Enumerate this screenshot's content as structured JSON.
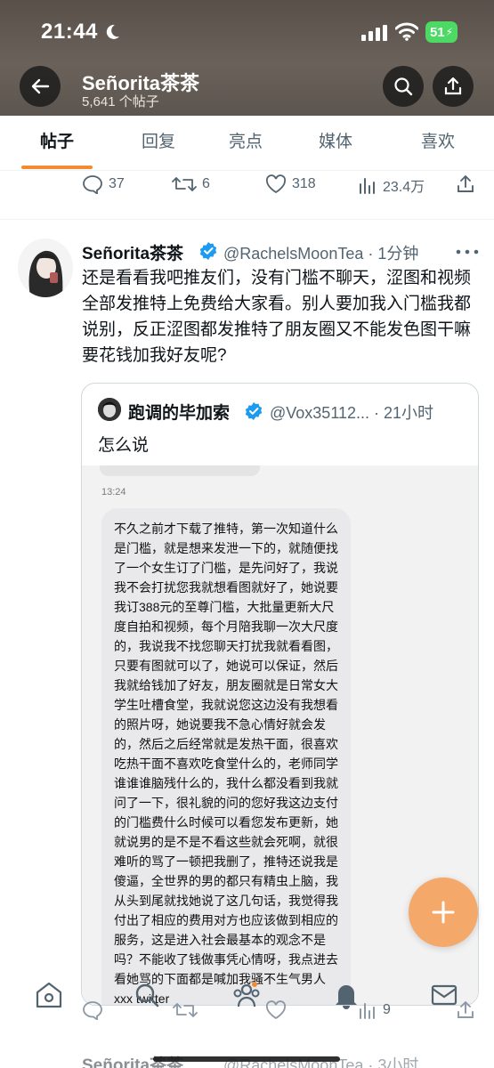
{
  "status_bar": {
    "time": "21:44",
    "battery": "51"
  },
  "profile": {
    "name": "Señorita茶茶",
    "post_count": "5,641 个帖子"
  },
  "tabs": [
    {
      "label": "帖子"
    },
    {
      "label": "回复"
    },
    {
      "label": "亮点"
    },
    {
      "label": "媒体"
    },
    {
      "label": "喜欢"
    }
  ],
  "prev_tweet_actions": {
    "replies": "37",
    "reposts": "6",
    "likes": "318",
    "views": "23.4万"
  },
  "tweet": {
    "name": "Señorita茶茶",
    "handle": "@RachelsMoonTea · 1分钟",
    "body": "还是看看我吧推友们，没有门槛不聊天，涩图和视频全部发推特上免费给大家看。别人要加我入门槛我都说别，反正涩图都发推特了朋友圈又不能发色图干嘛要花钱加我好友呢?",
    "quote": {
      "name": "跑调的毕加索",
      "handle": "@Vox35112... · 21小时",
      "text": "怎么说",
      "image_time": "13:24",
      "image_text": "不久之前才下载了推特，第一次知道什么是门槛，就是想来发泄一下的，就随便找了一个女生订了门槛，是先问好了，我说我不会打扰您我就想看图就好了，她说要我订388元的至尊门槛，大批量更新大尺度自拍和视频，每个月陪我聊一次大尺度的，我说我不找您聊天打扰我就看看图，只要有图就可以了，她说可以保证，然后我就给钱加了好友，朋友圈就是日常女大学生吐槽食堂，我就说您这边没有我想看的照片呀，她说要我不急心情好就会发的，然后之后经常就是发热干面，很喜欢吃热干面不喜欢吃食堂什么的，老师同学谁谁谁脑残什么的，我什么都没看到我就问了一下，很礼貌的问的您好我这边支付的门槛费什么时候可以看您发布更新，她就说男的是不是不看这些就会死啊，就很难听的骂了一顿把我删了，推特还说我是傻逼，全世界的男的都只有精虫上脑，我从头到尾就找她说了这几句话，我觉得我付出了相应的费用对方也应该做到相应的服务，这是进入社会最基本的观念不是吗？不能收了钱做事凭心情呀，我点进去看她骂的下面都是喊加我骚不生气男人 xxx twitter"
    },
    "actions": {
      "views": "9"
    }
  },
  "next_tweet": {
    "name": "Señorita茶茶",
    "handle": "@RachelsMoonTea · 3小时"
  },
  "colors": {
    "accent": "#f48a32",
    "fab": "#f4a86a",
    "verified": "#1d9bf0"
  }
}
